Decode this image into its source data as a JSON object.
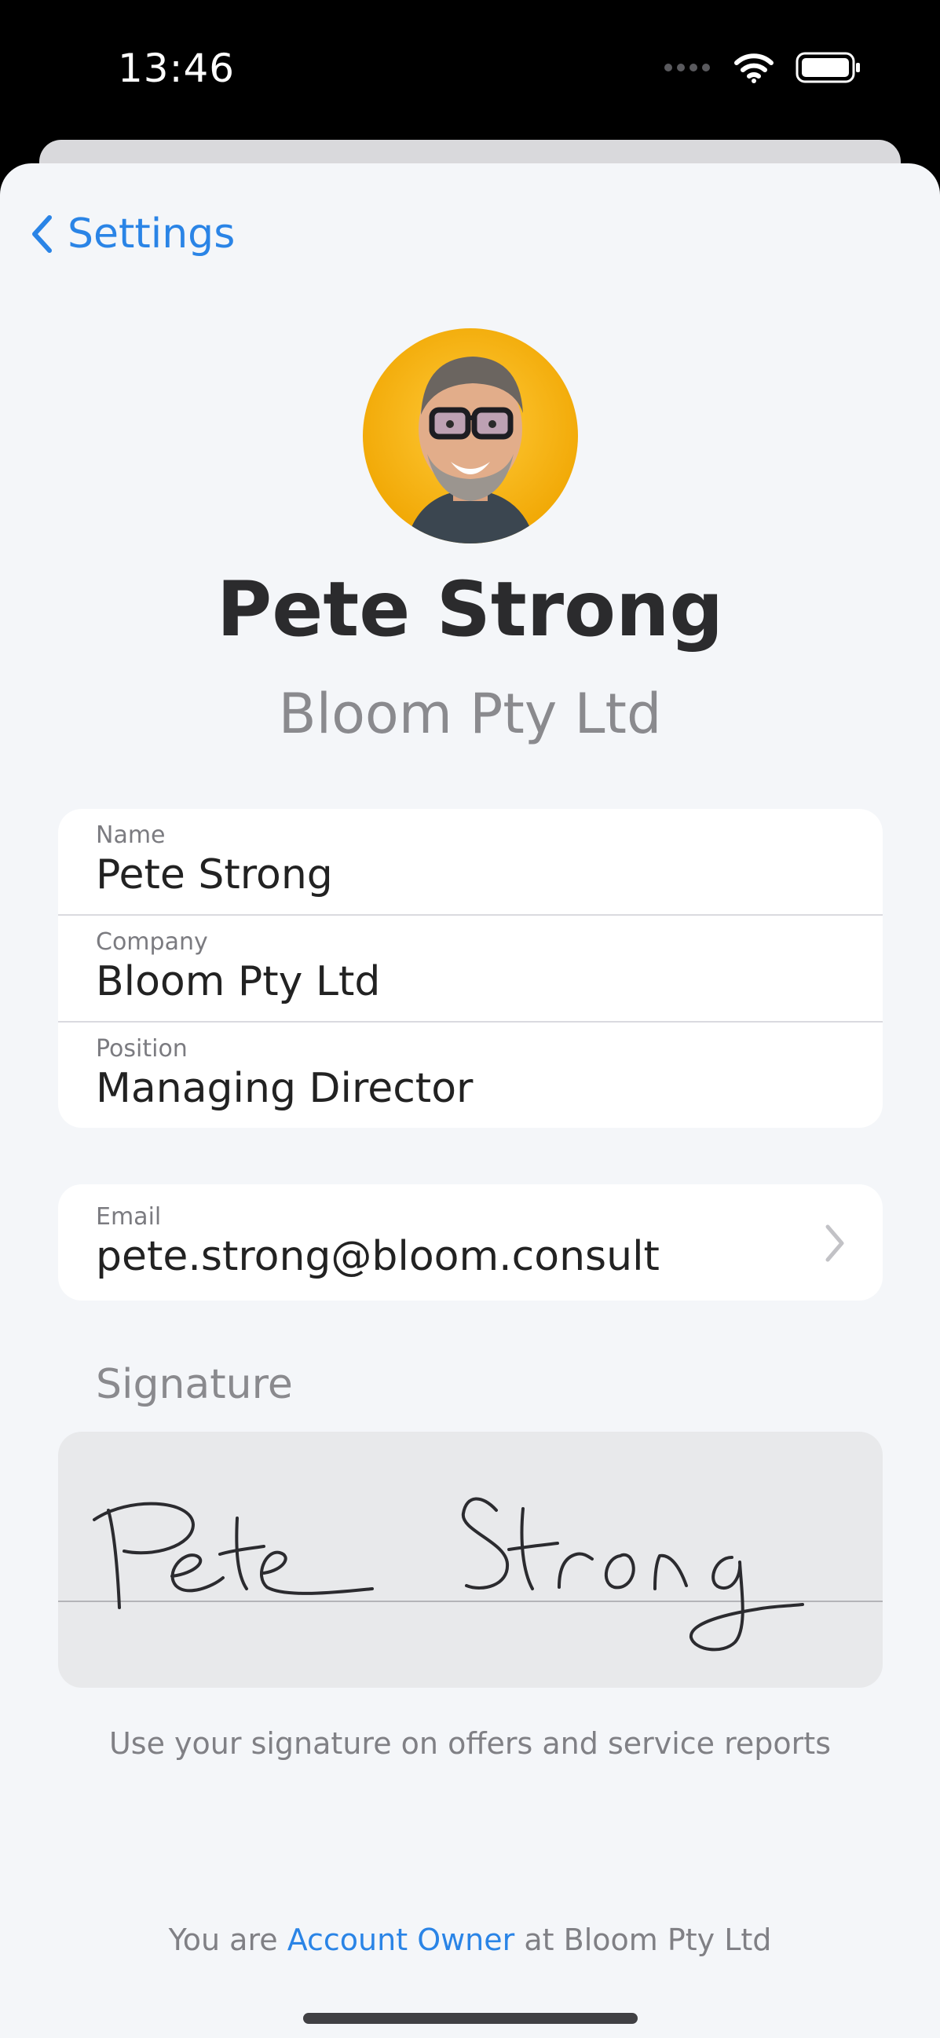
{
  "status": {
    "time": "13:46"
  },
  "nav": {
    "back_label": "Settings"
  },
  "profile": {
    "name": "Pete Strong",
    "company": "Bloom Pty Ltd"
  },
  "details": [
    {
      "label": "Name",
      "value": "Pete Strong"
    },
    {
      "label": "Company",
      "value": "Bloom Pty Ltd"
    },
    {
      "label": "Position",
      "value": "Managing Director"
    }
  ],
  "email": {
    "label": "Email",
    "value": "pete.strong@bloom.consult"
  },
  "signature": {
    "section_title": "Signature",
    "handwriting": "Pete Strong",
    "caption": "Use your signature on offers and service reports"
  },
  "footer": {
    "prefix": "You are ",
    "role": "Account Owner",
    "suffix": " at Bloom Pty Ltd"
  },
  "colors": {
    "accent": "#2a84e6",
    "background": "#f4f6f9"
  }
}
